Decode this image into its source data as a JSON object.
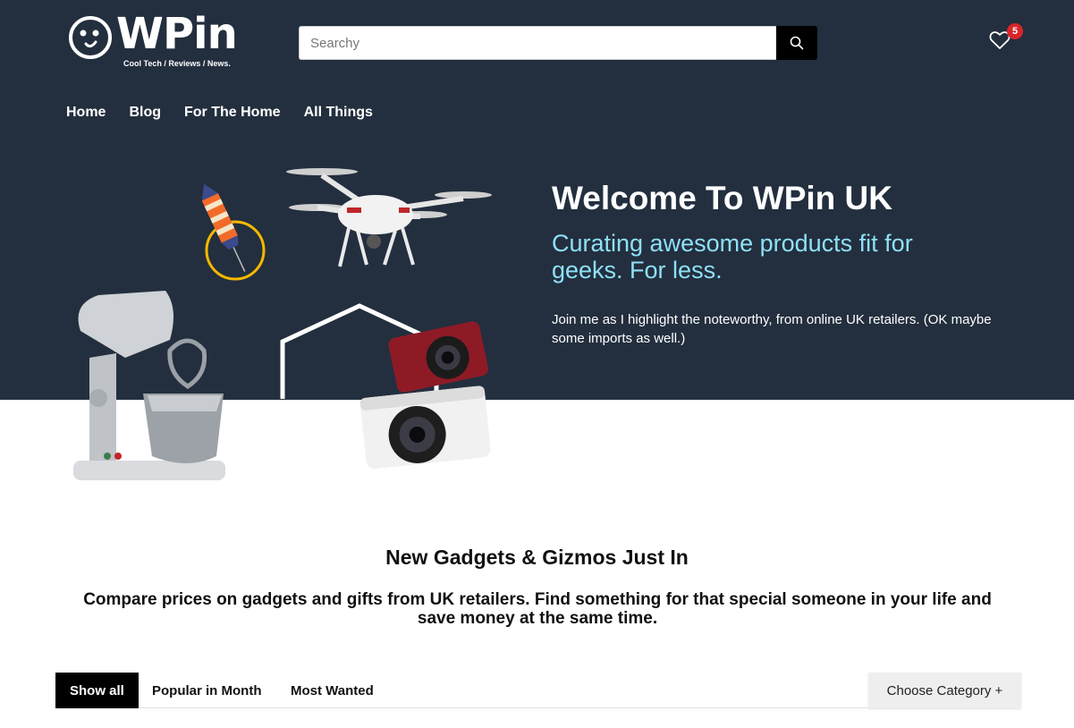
{
  "header": {
    "logo_text": "WPin",
    "logo_tagline": "Cool Tech / Reviews / News.",
    "search_placeholder": "Searchy",
    "wishlist_count": "5"
  },
  "nav": {
    "items": [
      {
        "label": "Home"
      },
      {
        "label": "Blog"
      },
      {
        "label": "For The Home"
      },
      {
        "label": "All Things"
      }
    ]
  },
  "hero": {
    "title": "Welcome To WPin UK",
    "subtitle": "Curating awesome products fit for geeks. For less.",
    "body": "Join me as I highlight the noteworthy, from online UK retailers. (OK maybe some imports as well.)"
  },
  "section": {
    "title": "New Gadgets & Gizmos Just In",
    "description": "Compare prices on gadgets and gifts from UK retailers. Find something for that special someone in your life and save money at the same time."
  },
  "filters": {
    "tabs": [
      {
        "label": "Show all"
      },
      {
        "label": "Popular in Month"
      },
      {
        "label": "Most Wanted"
      }
    ],
    "category_label": "Choose Category +"
  },
  "colors": {
    "header_bg": "#232f3e",
    "accent_cyan": "#8ee0f7",
    "badge_red": "#d9252a"
  },
  "icons": [
    "logo-face-icon",
    "search-icon",
    "heart-icon",
    "rocket-icon",
    "drone-icon",
    "stand-mixer-icon",
    "camera-icon"
  ]
}
